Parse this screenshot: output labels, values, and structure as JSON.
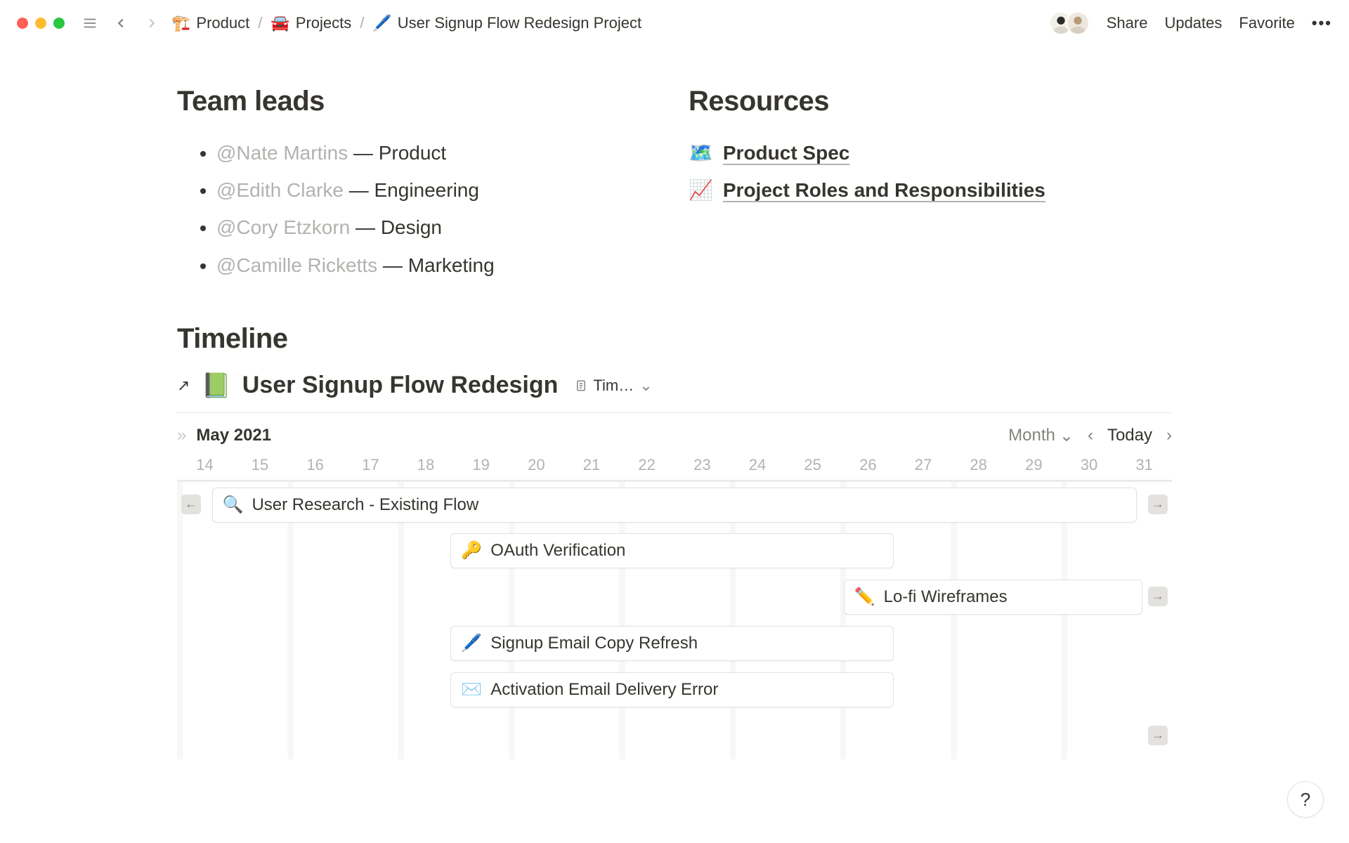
{
  "breadcrumbs": [
    {
      "icon": "🏗️",
      "label": "Product"
    },
    {
      "icon": "🚘",
      "label": "Projects"
    },
    {
      "icon": "🖊️",
      "label": "User Signup Flow Redesign Project"
    }
  ],
  "topbar": {
    "share": "Share",
    "updates": "Updates",
    "favorite": "Favorite"
  },
  "sections": {
    "team_leads": {
      "heading": "Team leads",
      "items": [
        {
          "mention": "@Nate Martins",
          "role": "Product"
        },
        {
          "mention": "@Edith Clarke",
          "role": "Engineering"
        },
        {
          "mention": "@Cory Etzkorn",
          "role": "Design"
        },
        {
          "mention": "@Camille Ricketts",
          "role": "Marketing"
        }
      ]
    },
    "resources": {
      "heading": "Resources",
      "items": [
        {
          "icon": "🗺️",
          "label": "Product Spec"
        },
        {
          "icon": "📈",
          "label": "Project Roles and Responsibilities"
        }
      ]
    }
  },
  "timeline": {
    "heading": "Timeline",
    "db_icon": "📗",
    "db_title": "User Signup Flow Redesign",
    "view_label": "Tim…",
    "month_label": "May 2021",
    "scale": "Month",
    "today": "Today",
    "days": [
      "14",
      "15",
      "16",
      "17",
      "18",
      "19",
      "20",
      "21",
      "22",
      "23",
      "24",
      "25",
      "26",
      "27",
      "28",
      "29",
      "30",
      "31"
    ],
    "tasks": [
      {
        "icon": "🔍",
        "label": "User Research - Existing Flow",
        "start_pct": 0,
        "width_pct": 100,
        "overflow_left": true,
        "overflow_right": true
      },
      {
        "icon": "🔑",
        "label": "OAuth Verification",
        "start_pct": 27.5,
        "width_pct": 44.5
      },
      {
        "icon": "✏️",
        "label": "Lo-fi Wireframes",
        "start_pct": 67,
        "width_pct": 33,
        "overflow_right": true
      },
      {
        "icon": "🖊️",
        "label": "Signup Email Copy Refresh",
        "start_pct": 27.5,
        "width_pct": 44.5
      },
      {
        "icon": "✉️",
        "label": "Activation Email Delivery Error",
        "start_pct": 27.5,
        "width_pct": 44.5
      },
      {
        "icon": "",
        "label": "",
        "start_pct": 95,
        "width_pct": 5,
        "overflow_right": true,
        "empty": true
      }
    ]
  },
  "help": "?"
}
